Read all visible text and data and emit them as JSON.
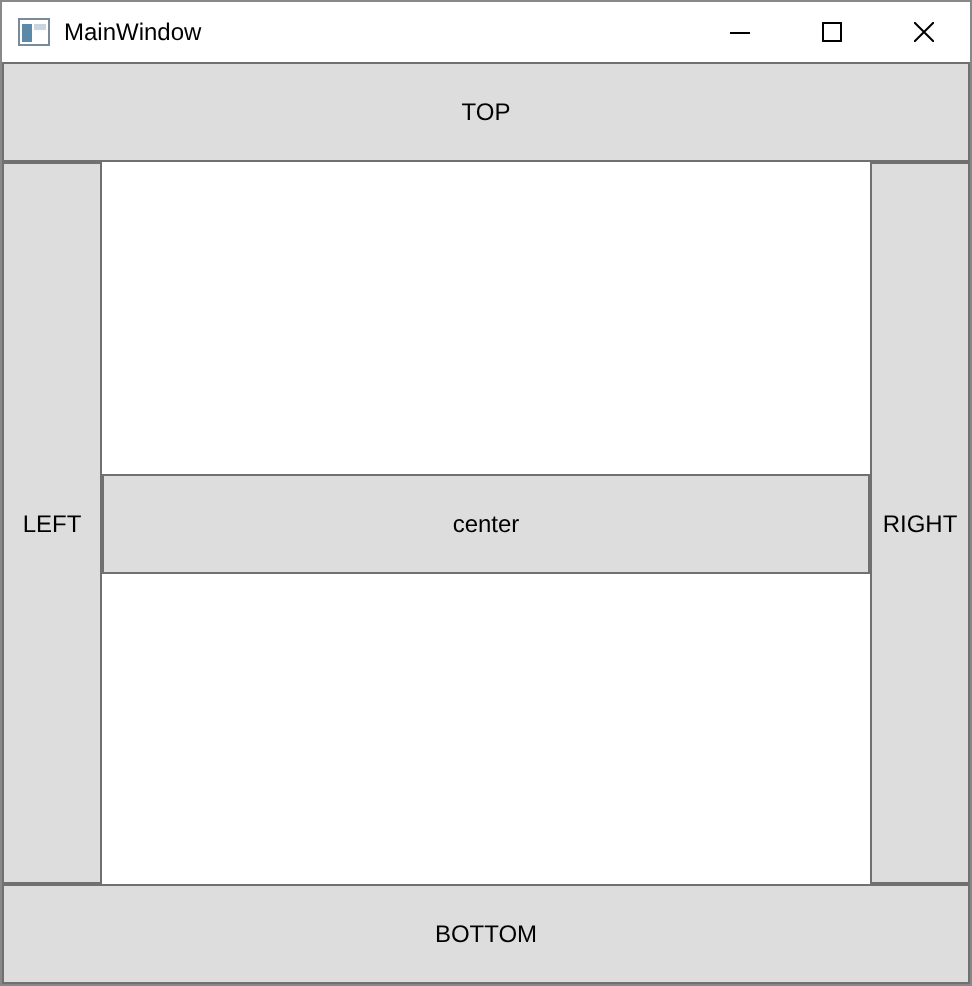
{
  "window": {
    "title": "MainWindow"
  },
  "buttons": {
    "top": "TOP",
    "left": "LEFT",
    "center": "center",
    "right": "RIGHT",
    "bottom": "BOTTOM"
  }
}
